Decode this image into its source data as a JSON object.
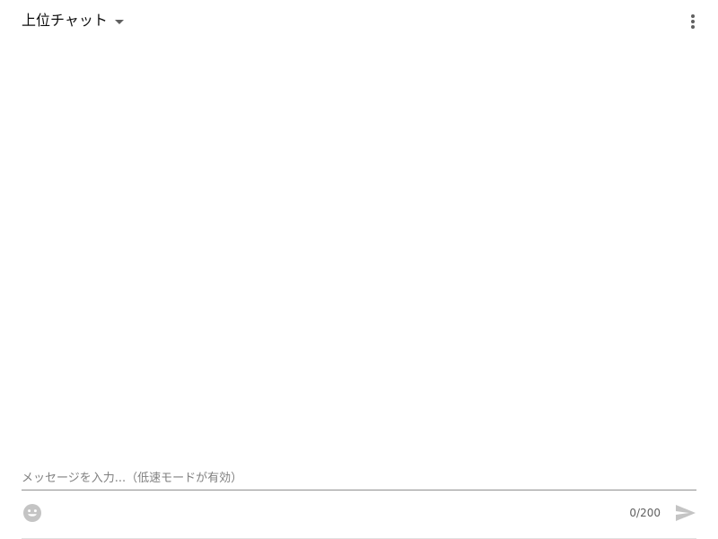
{
  "header": {
    "chat_mode_label": "上位チャット",
    "dropdown_icon": "caret-down-icon",
    "more_icon": "more-vertical-icon"
  },
  "input": {
    "placeholder": "メッセージを入力...（低速モードが有効）",
    "char_counter": "0/200",
    "emoji_icon": "emoji-icon",
    "send_icon": "send-icon"
  },
  "colors": {
    "text_primary": "#0f0f0f",
    "text_secondary": "#606060",
    "placeholder": "#808080",
    "underline": "#909090",
    "icon_disabled": "#c4c4c4",
    "icon_default": "#606060"
  }
}
